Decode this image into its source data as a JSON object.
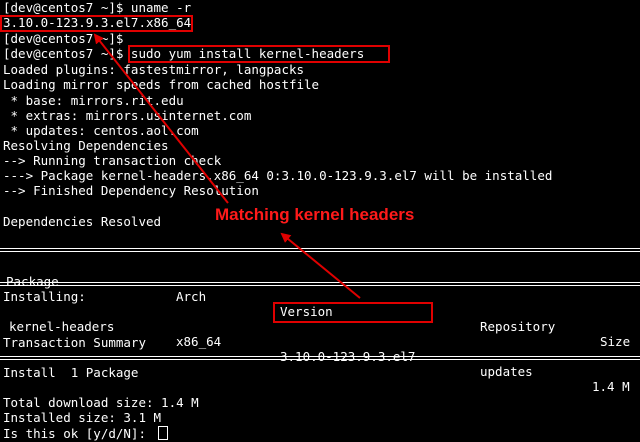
{
  "terminal": {
    "lines": [
      "[dev@centos7 ~]$ uname -r",
      "3.10.0-123.9.3.el7.x86_64",
      "[dev@centos7 ~]$",
      "[dev@centos7 ~]$ sudo yum install kernel-headers",
      "Loaded plugins: fastestmirror, langpacks",
      "Loading mirror speeds from cached hostfile",
      " * base: mirrors.rit.edu",
      " * extras: mirrors.usinternet.com",
      " * updates: centos.aol.com",
      "Resolving Dependencies",
      "--> Running transaction check",
      "---> Package kernel-headers.x86_64 0:3.10.0-123.9.3.el7 will be installed",
      "--> Finished Dependency Resolution",
      "",
      "Dependencies Resolved"
    ],
    "table": {
      "headers": [
        "Package",
        "Arch",
        "Version",
        "Repository",
        "Size"
      ],
      "section_label": "Installing:",
      "row": [
        "kernel-headers",
        "x86_64",
        "3.10.0-123.9.3.el7",
        "updates",
        "1.4 M"
      ]
    },
    "summary_label": "Transaction Summary",
    "install_line": "Install  1 Package",
    "total_download": "Total download size: 1.4 M",
    "installed_size": "Installed size: 3.1 M",
    "prompt": "Is this ok [y/d/N]: "
  },
  "annotation": {
    "text": "Matching kernel headers",
    "color": "#ff1a1a"
  },
  "colors": {
    "background": "#000000",
    "text": "#ffffff",
    "highlight": "#e00000"
  }
}
